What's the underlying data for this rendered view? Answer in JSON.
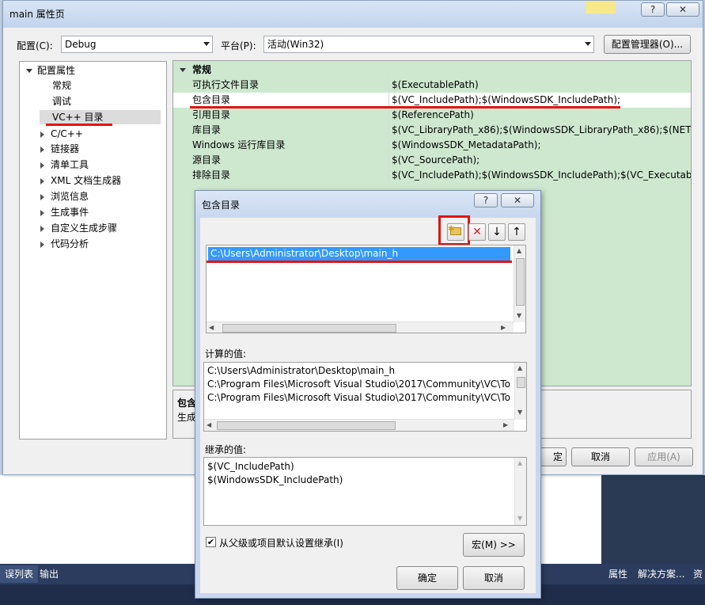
{
  "window": {
    "title": "main 属性页"
  },
  "config": {
    "config_label": "配置(C):",
    "config_value": "Debug",
    "platform_label": "平台(P):",
    "platform_value": "活动(Win32)",
    "manager_button": "配置管理器(O)..."
  },
  "tree": {
    "root": "配置属性",
    "children": [
      "常规",
      "调试",
      "VC++ 目录"
    ],
    "expandable": [
      "C/C++",
      "链接器",
      "清单工具",
      "XML 文档生成器",
      "浏览信息",
      "生成事件",
      "自定义生成步骤",
      "代码分析"
    ]
  },
  "grid": {
    "section": "常规",
    "rows": [
      {
        "name": "可执行文件目录",
        "value": "$(ExecutablePath)"
      },
      {
        "name": "包含目录",
        "value": "$(VC_IncludePath);$(WindowsSDK_IncludePath);"
      },
      {
        "name": "引用目录",
        "value": "$(ReferencePath)"
      },
      {
        "name": "库目录",
        "value": "$(VC_LibraryPath_x86);$(WindowsSDK_LibraryPath_x86);$(NETFXK"
      },
      {
        "name": "Windows 运行库目录",
        "value": "$(WindowsSDK_MetadataPath);"
      },
      {
        "name": "源目录",
        "value": "$(VC_SourcePath);"
      },
      {
        "name": "排除目录",
        "value": "$(VC_IncludePath);$(WindowsSDK_IncludePath);$(VC_ExecutablePa"
      }
    ]
  },
  "description": {
    "title": "包含",
    "text": "生成"
  },
  "main_buttons": {
    "ok_partial": "定",
    "cancel": "取消",
    "apply": "应用(A)"
  },
  "include_dialog": {
    "title": "包含目录",
    "help": "?",
    "close": "✕",
    "entries": [
      "C:\\Users\\Administrator\\Desktop\\main_h"
    ],
    "computed_label": "计算的值:",
    "computed": [
      "C:\\Users\\Administrator\\Desktop\\main_h",
      "C:\\Program Files\\Microsoft Visual Studio\\2017\\Community\\VC\\To",
      "C:\\Program Files\\Microsoft Visual Studio\\2017\\Community\\VC\\To"
    ],
    "inherited_label": "继承的值:",
    "inherited": [
      "$(VC_IncludePath)",
      "$(WindowsSDK_IncludePath)"
    ],
    "inherit_checkbox": "从父级或项目默认设置继承(I)",
    "macro_button": "宏(M) >>",
    "ok": "确定",
    "cancel": "取消"
  },
  "vs": {
    "tab_errors": "误列表",
    "tab_output": "输出",
    "right_tabs": [
      "属性",
      "解决方案...",
      "资"
    ]
  },
  "colors": {
    "highlight_red": "#e31313",
    "selection_blue": "#3399ff",
    "grid_green": "#cde8cf"
  }
}
